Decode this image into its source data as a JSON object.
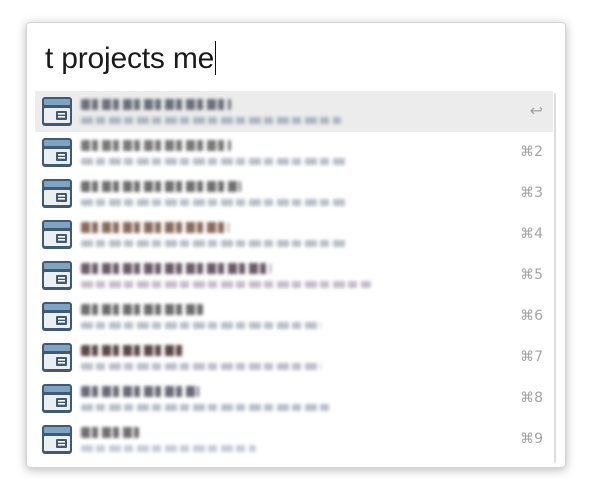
{
  "query": {
    "text": "t projects me"
  },
  "results": [
    {
      "hint": "↩",
      "selected": true,
      "title_w": 150,
      "sub_w": 260,
      "title_color": "#6b6f7a",
      "sub_color": "#9aa3b4"
    },
    {
      "hint": "⌘2",
      "selected": false,
      "title_w": 150,
      "sub_w": 265,
      "title_color": "#787878",
      "sub_color": "#a4aab6"
    },
    {
      "hint": "⌘3",
      "selected": false,
      "title_w": 160,
      "sub_w": 265,
      "title_color": "#6f6f6f",
      "sub_color": "#a4aab6"
    },
    {
      "hint": "⌘4",
      "selected": false,
      "title_w": 148,
      "sub_w": 265,
      "title_color": "#8a6a5a",
      "sub_color": "#a4aab6"
    },
    {
      "hint": "⌘5",
      "selected": false,
      "title_w": 190,
      "sub_w": 290,
      "title_color": "#6a5b66",
      "sub_color": "#b2a6b8"
    },
    {
      "hint": "⌘6",
      "selected": false,
      "title_w": 122,
      "sub_w": 240,
      "title_color": "#6d6d6d",
      "sub_color": "#a4aab6"
    },
    {
      "hint": "⌘7",
      "selected": false,
      "title_w": 105,
      "sub_w": 240,
      "title_color": "#5a4848",
      "sub_color": "#a8aab6"
    },
    {
      "hint": "⌘8",
      "selected": false,
      "title_w": 118,
      "sub_w": 250,
      "title_color": "#6a6a78",
      "sub_color": "#a4aab6"
    },
    {
      "hint": "⌘9",
      "selected": false,
      "title_w": 58,
      "sub_w": 175,
      "title_color": "#6f6f6f",
      "sub_color": "#b6bcc6"
    }
  ],
  "colors": {
    "icon_dark": "#3f5a72",
    "icon_light": "#7fa3c2"
  },
  "icons": {
    "result": "web-link-card-icon"
  }
}
